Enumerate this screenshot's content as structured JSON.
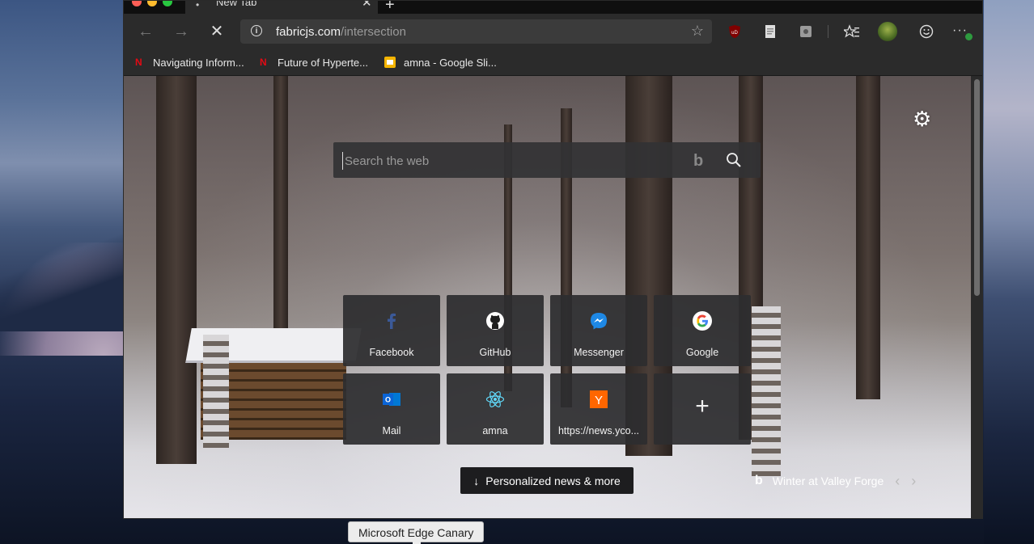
{
  "browser": {
    "tab": {
      "title": "New Tab"
    },
    "address": {
      "domain": "fabricjs.com",
      "path": "/intersection"
    },
    "bookmarks": [
      {
        "label": "Navigating Inform...",
        "icon": "netflix-icon"
      },
      {
        "label": "Future of Hyperte...",
        "icon": "netflix-icon"
      },
      {
        "label": "amna - Google Sli...",
        "icon": "google-slides-icon"
      }
    ]
  },
  "newtab": {
    "search": {
      "placeholder": "Search the web"
    },
    "tiles": [
      {
        "label": "Facebook",
        "icon": "facebook-icon",
        "color": "#3b5998"
      },
      {
        "label": "GitHub",
        "icon": "github-icon",
        "color": "#ffffff"
      },
      {
        "label": "Messenger",
        "icon": "messenger-icon",
        "color": "#1e88e5"
      },
      {
        "label": "Google",
        "icon": "google-icon",
        "color": "#4285f4"
      },
      {
        "label": "Mail",
        "icon": "outlook-icon",
        "color": "#0a64d6"
      },
      {
        "label": "amna",
        "icon": "react-icon",
        "color": "#61dafb"
      },
      {
        "label": "https://news.yco...",
        "icon": "ycombinator-icon",
        "color": "#ff6600"
      },
      {
        "label": "",
        "icon": "add-icon",
        "color": "#eeeeee"
      }
    ],
    "news_button": "Personalized news & more",
    "photo_title": "Winter at Valley Forge"
  },
  "tooltip": "Microsoft Edge Canary"
}
